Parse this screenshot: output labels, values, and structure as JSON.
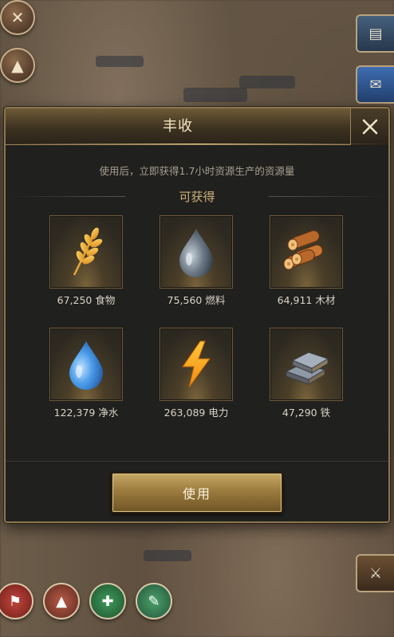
{
  "dialog": {
    "title": "丰收",
    "description": "使用后，立即获得1.7小时资源生产的资源量",
    "subtitle": "可获得",
    "use_button": "使用",
    "resources": [
      {
        "label": "67,250 食物",
        "icon": "wheat-icon"
      },
      {
        "label": "75,560 燃料",
        "icon": "fuel-drop-icon"
      },
      {
        "label": "64,911 木材",
        "icon": "wood-logs-icon"
      },
      {
        "label": "122,379 净水",
        "icon": "water-drop-icon"
      },
      {
        "label": "263,089 电力",
        "icon": "lightning-icon"
      },
      {
        "label": "47,290 铁",
        "icon": "iron-ingot-icon"
      }
    ]
  },
  "colors": {
    "title_text": "#f2e6c6",
    "subtitle_text": "#cdb27a",
    "button_gold": "#9c7c3e",
    "panel_bg": "#20201e"
  }
}
